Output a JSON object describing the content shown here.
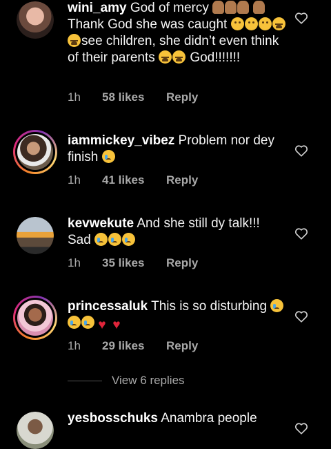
{
  "comments": [
    {
      "username": "wini_amy",
      "text_a": "God of mercy",
      "text_b": "Thank God she was caught",
      "text_c": "see children, she didn’t even think of their parents",
      "text_d": "God!!!!!!!",
      "time": "1h",
      "likes": "58 likes",
      "reply": "Reply"
    },
    {
      "username": "iammickey_vibez",
      "text_a": "Problem nor dey finish",
      "time": "1h",
      "likes": "41 likes",
      "reply": "Reply"
    },
    {
      "username": "kevwekute",
      "text_a": "And she still dy talk!!!",
      "text_b": "Sad",
      "time": "1h",
      "likes": "35 likes",
      "reply": "Reply"
    },
    {
      "username": "princessaluk",
      "text_a": "This is so disturbing",
      "time": "1h",
      "likes": "29 likes",
      "reply": "Reply"
    },
    {
      "username": "yesbosschuks",
      "text_a": "Anambra people"
    }
  ],
  "view_replies": "View 6 replies",
  "colors": {
    "background": "#000000",
    "text": "#ffffff",
    "muted": "#a8a8a8",
    "story_ring_start": "#f58529",
    "story_ring_end": "#dd2a7b"
  },
  "icons": {
    "like": "heart-outline-icon",
    "emoji_pray": "folded-hands-emoji",
    "emoji_sad": "pensive-face-emoji",
    "emoji_tired": "tired-face-emoji",
    "emoji_cry": "crying-face-emoji",
    "emoji_broken": "broken-heart-emoji"
  }
}
